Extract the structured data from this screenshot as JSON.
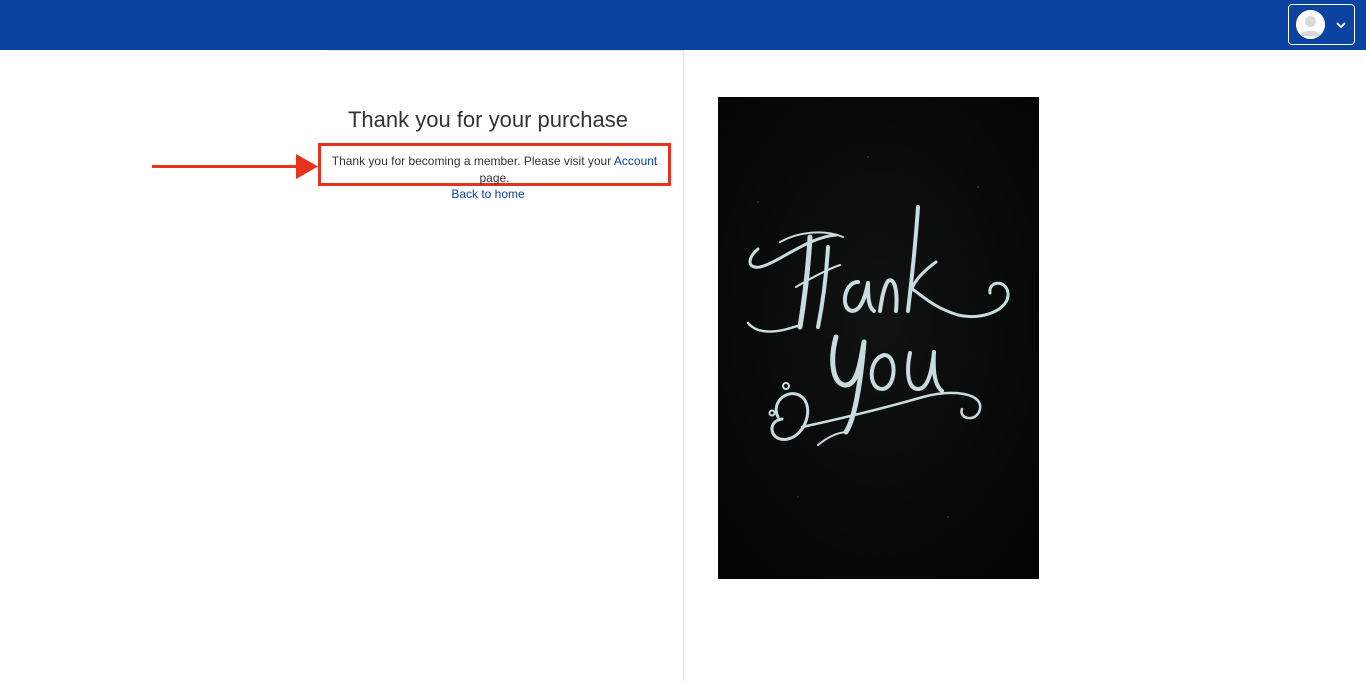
{
  "header": {
    "brand_color": "#0a43a0",
    "user_menu": {
      "avatar_icon": "user-avatar-icon",
      "dropdown_icon": "chevron-down-icon"
    }
  },
  "main": {
    "title": "Thank you for your purchase",
    "message": {
      "text_before_link": "Thank you for becoming a member. Please visit your ",
      "link_text": "Account",
      "text_after_link": " page."
    },
    "back_link": "Back to home",
    "highlight_color": "#e8321e"
  },
  "image": {
    "subject": "chalk lettering on black",
    "lettering": "Thank you"
  }
}
